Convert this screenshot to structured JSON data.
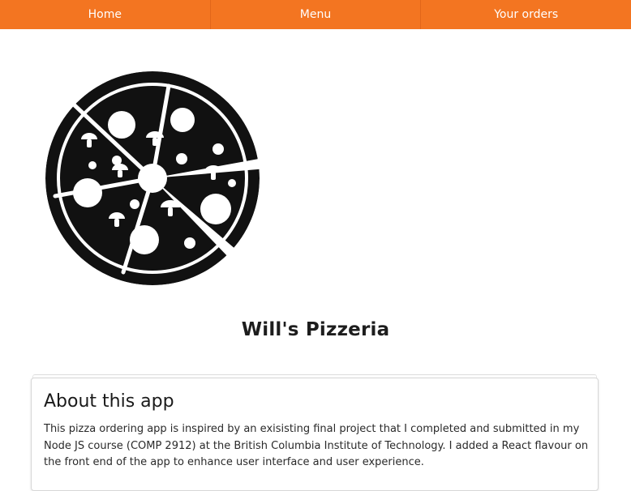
{
  "nav": {
    "items": [
      {
        "label": "Home"
      },
      {
        "label": "Menu"
      },
      {
        "label": "Your orders"
      }
    ]
  },
  "colors": {
    "nav_bg": "#f37521",
    "logo": "#111111"
  },
  "logo": {
    "icon": "pizza-icon"
  },
  "site": {
    "title": "Will's Pizzeria"
  },
  "about": {
    "title": "About this app",
    "text": "This pizza ordering app is inspired by an exisisting final project that I completed and submitted in my Node JS course (COMP 2912) at the British Columbia Institute of Technology. I added a React flavour on the front end of the app to enhance user interface and user experience."
  }
}
